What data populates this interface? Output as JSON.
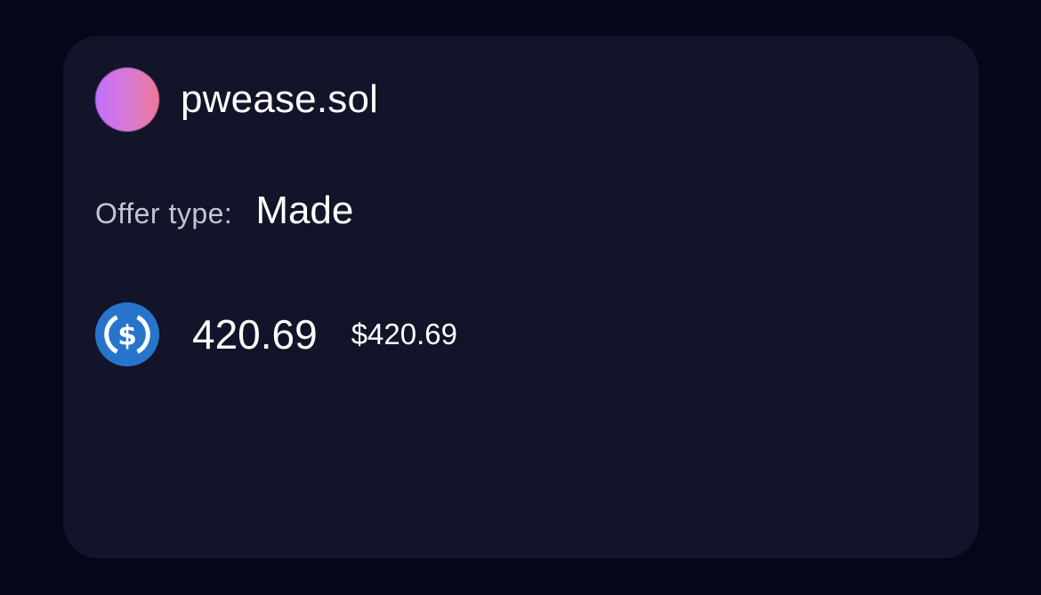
{
  "profile": {
    "username": "pwease.sol",
    "avatar_colors": [
      "#c170ff",
      "#ef7897"
    ]
  },
  "offer": {
    "label": "Offer type:",
    "value": "Made"
  },
  "amount": {
    "token_icon": "usdc-icon",
    "token_color": "#2775ca",
    "value": "420.69",
    "usd_value": "$420.69"
  },
  "colors": {
    "background": "#05061a",
    "card": "#121429",
    "label_text": "#c4c5d2"
  }
}
